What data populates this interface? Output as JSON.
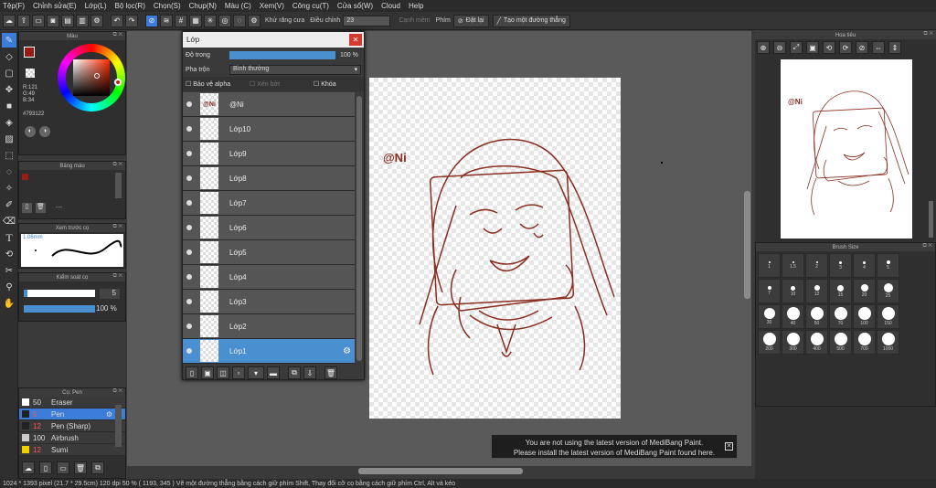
{
  "menu": [
    "Tệp(F)",
    "Chỉnh sửa(E)",
    "Lớp(L)",
    "Bộ lọc(R)",
    "Chọn(S)",
    "Chụp(N)",
    "Màu (C)",
    "Xem(V)",
    "Công cụ(T)",
    "Cửa sổ(W)",
    "Cloud",
    "Help"
  ],
  "toolbar": {
    "antialias_label": "Khử răng cưa",
    "adjust_label": "Điều chỉnh",
    "adjust_value": "23",
    "soft_edge_label": "Cạnh mềm",
    "key_label": "Phím",
    "reset_label": "Đặt lại",
    "make_line_label": "Tạo một đường thẳng"
  },
  "color_panel": {
    "title": "Màu",
    "rgb": "R:121\nG:49\nB:34",
    "hex": "#793122",
    "fg_color": "#9c1c14"
  },
  "palette_panel": {
    "title": "Bảng màu"
  },
  "brush_preview": {
    "title": "Xem trước cọ",
    "size": "1.06mm"
  },
  "brush_control": {
    "title": "Kiểm soát cọ",
    "size_value": "5",
    "opacity_value": "100 %"
  },
  "brush_list": {
    "title": "Cọ: Pen",
    "items": [
      {
        "size": "50",
        "name": "Eraser",
        "color": "#ffffff"
      },
      {
        "size": "5",
        "name": "Pen",
        "color": "#222222"
      },
      {
        "size": "12",
        "name": "Pen (Sharp)",
        "color": "#222222"
      },
      {
        "size": "100",
        "name": "Airbrush",
        "color": "#cccccc"
      },
      {
        "size": "12",
        "name": "Sumi",
        "color": "#f0d000"
      }
    ]
  },
  "layer_panel": {
    "title": "Lớp",
    "opacity_label": "Độ trong",
    "opacity_value": "100 %",
    "blend_label": "Pha trộn",
    "blend_value": "Bình thường",
    "protect_alpha": "Bảo vệ alpha",
    "clipping": "Xén bớt",
    "lock": "Khóa",
    "layers": [
      "@Ni",
      "Lớp10",
      "Lớp9",
      "Lớp8",
      "Lớp7",
      "Lớp6",
      "Lớp5",
      "Lớp4",
      "Lớp3",
      "Lớp2",
      "Lớp1"
    ],
    "thumb_text": "@Ni"
  },
  "canvas": {
    "signature": "@Ni",
    "line_color": "#8a2e20"
  },
  "navigator": {
    "title": "Hoa tiêu",
    "signature": "@Ni"
  },
  "brush_size": {
    "title": "Brush Size",
    "sizes": [
      {
        "label": "1",
        "d": 1
      },
      {
        "label": "1.5",
        "d": 1
      },
      {
        "label": "2",
        "d": 1
      },
      {
        "label": "3",
        "d": 2
      },
      {
        "label": "4",
        "d": 2
      },
      {
        "label": "5",
        "d": 3
      },
      {
        "label": "7",
        "d": 3
      },
      {
        "label": "10",
        "d": 4
      },
      {
        "label": "12",
        "d": 5
      },
      {
        "label": "15",
        "d": 6
      },
      {
        "label": "20",
        "d": 7
      },
      {
        "label": "25",
        "d": 9
      },
      {
        "label": "30",
        "d": 11
      },
      {
        "label": "40",
        "d": 13
      },
      {
        "label": "50",
        "d": 13
      },
      {
        "label": "70",
        "d": 13
      },
      {
        "label": "100",
        "d": 13
      },
      {
        "label": "150",
        "d": 13
      },
      {
        "label": "200",
        "d": 13
      },
      {
        "label": "300",
        "d": 13
      },
      {
        "label": "400",
        "d": 13
      },
      {
        "label": "500",
        "d": 13
      },
      {
        "label": "700",
        "d": 13
      },
      {
        "label": "1000",
        "d": 13
      }
    ]
  },
  "notice": {
    "line1": "You are not using the latest version of MediBang Paint.",
    "line2": "Please install the latest version of MediBang Paint found here."
  },
  "status": "1024 * 1393 pixel   (21.7 * 29.5cm)   120 dpi   50 %   ( 1193, 345 )   Vẽ một đường thẳng bằng cách giữ phím Shift, Thay đổi cỡ cọ bằng cách giữ phím Ctrl, Alt và kéo"
}
